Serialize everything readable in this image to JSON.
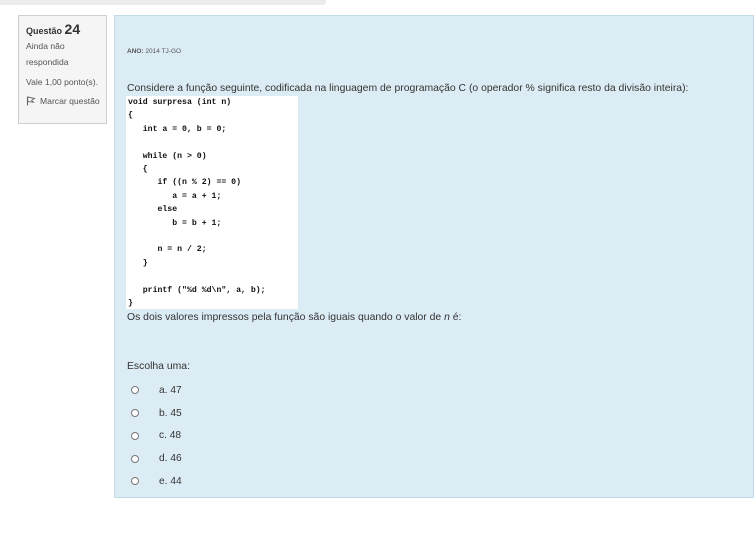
{
  "info": {
    "question_label": "Questão",
    "question_number": "24",
    "state_line1": "Ainda não",
    "state_line2": "respondida",
    "grade": "Vale 1,00 ponto(s).",
    "flag_label": "Marcar questão"
  },
  "question": {
    "year_label": "ANO:",
    "year_value": "2014 TJ-GO",
    "statement": "Considere a função seguinte, codificada na linguagem de programação C (o operador % significa resto da divisão inteira):",
    "code": "void surpresa (int n)\n{\n   int a = 0, b = 0;\n\n   while (n > 0)\n   {\n      if ((n % 2) == 0)\n         a = a + 1;\n      else\n         b = b + 1;\n\n      n = n / 2;\n   }\n\n   printf (\"%d %d\\n\", a, b);\n}",
    "follow_before": "Os dois valores impressos pela função são iguais quando o valor de ",
    "follow_var": "n",
    "follow_after": " é:",
    "choose_label": "Escolha uma:",
    "options": [
      {
        "label": "a. 47"
      },
      {
        "label": "b. 45"
      },
      {
        "label": "c. 48"
      },
      {
        "label": "d. 46"
      },
      {
        "label": "e. 44"
      }
    ]
  }
}
